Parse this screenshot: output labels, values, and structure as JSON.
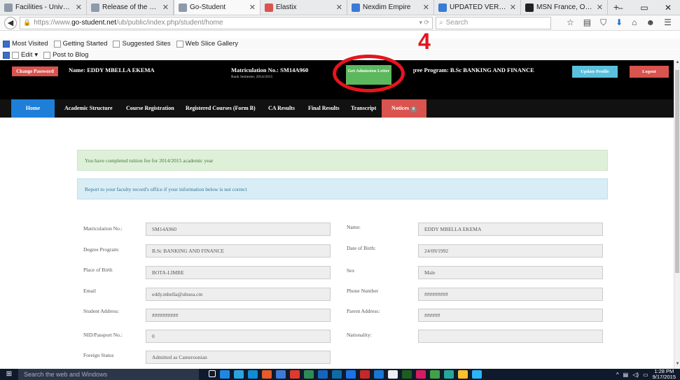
{
  "browser": {
    "tabs": [
      {
        "label": "Facilities - Univer...",
        "color": "#8e9aa8",
        "active": false
      },
      {
        "label": "Release of the Fir...",
        "color": "#8e9aa8",
        "active": false
      },
      {
        "label": "Go-Student",
        "color": "#8e9aa8",
        "active": true
      },
      {
        "label": "Elastix",
        "color": "#d9534f",
        "active": false
      },
      {
        "label": "Nexdim Empire",
        "color": "#3a7bd5",
        "active": false
      },
      {
        "label": "UPDATED VERSI...",
        "color": "#3a7bd5",
        "active": false
      },
      {
        "label": "MSN France, Out...",
        "color": "#222222",
        "active": false
      }
    ],
    "url_scheme": "https://www.",
    "url_host": "go-student.net",
    "url_path": "/ub/public/index.php/student/home",
    "search_placeholder": "Search",
    "bookmarks": [
      "Most Visited",
      "Getting Started",
      "Suggested Sites",
      "Web Slice Gallery"
    ],
    "toolbar2": [
      "Edit",
      "Post to Blog"
    ]
  },
  "header": {
    "change_password": "Change Password",
    "name": "Name: EDDY MBELLA EKEMA",
    "matric": "Matriculation No.: SM14A960",
    "matric_sub": "Rank Semester, 2014/2015",
    "admission_btn": "Get Admission Letter",
    "degree": "Degree Program: B.Sc BANKING AND FINANCE",
    "update_profile": "Update Profile",
    "logout": "Logout",
    "annotation_number": "4"
  },
  "nav": {
    "items": [
      "Home",
      "Academic Structure",
      "Course Registration",
      "Registered Courses (Form B)",
      "CA Results",
      "Final Results",
      "Transcript"
    ],
    "notices": "Notices",
    "notices_count": "0"
  },
  "alerts": {
    "success": "You have completed tuition fee for 2014/2015 academic year",
    "info": "Report to your faculty record's office if your information below is not correct"
  },
  "profile": {
    "left": [
      {
        "label": "Matriculation No.:",
        "value": "SM14A960"
      },
      {
        "label": "Degree Program:",
        "value": "B.Sc BANKING AND FINANCE"
      },
      {
        "label": "Place of Birth",
        "value": "BOTA-LIMBE"
      },
      {
        "label": "Email",
        "value": "eddy.mbella@ubuea.cm"
      },
      {
        "label": "Student Address:",
        "value": "##########"
      },
      {
        "label": "NID/Passport No.:",
        "value": "0"
      },
      {
        "label": "Foreign Status",
        "value": "Admitted as Cameroonian"
      }
    ],
    "right": [
      {
        "label": "Name:",
        "value": "EDDY MBELLA EKEMA"
      },
      {
        "label": "Date of Birth:",
        "value": "24/09/1992"
      },
      {
        "label": "Sex",
        "value": "Male"
      },
      {
        "label": "Phone Number",
        "value": "#########"
      },
      {
        "label": "Parent Address:",
        "value": "######"
      },
      {
        "label": "Nationality:",
        "value": ""
      }
    ]
  },
  "taskbar": {
    "search_placeholder": "Search the web and Windows",
    "time": "1:28 PM",
    "date": "9/17/2015"
  }
}
